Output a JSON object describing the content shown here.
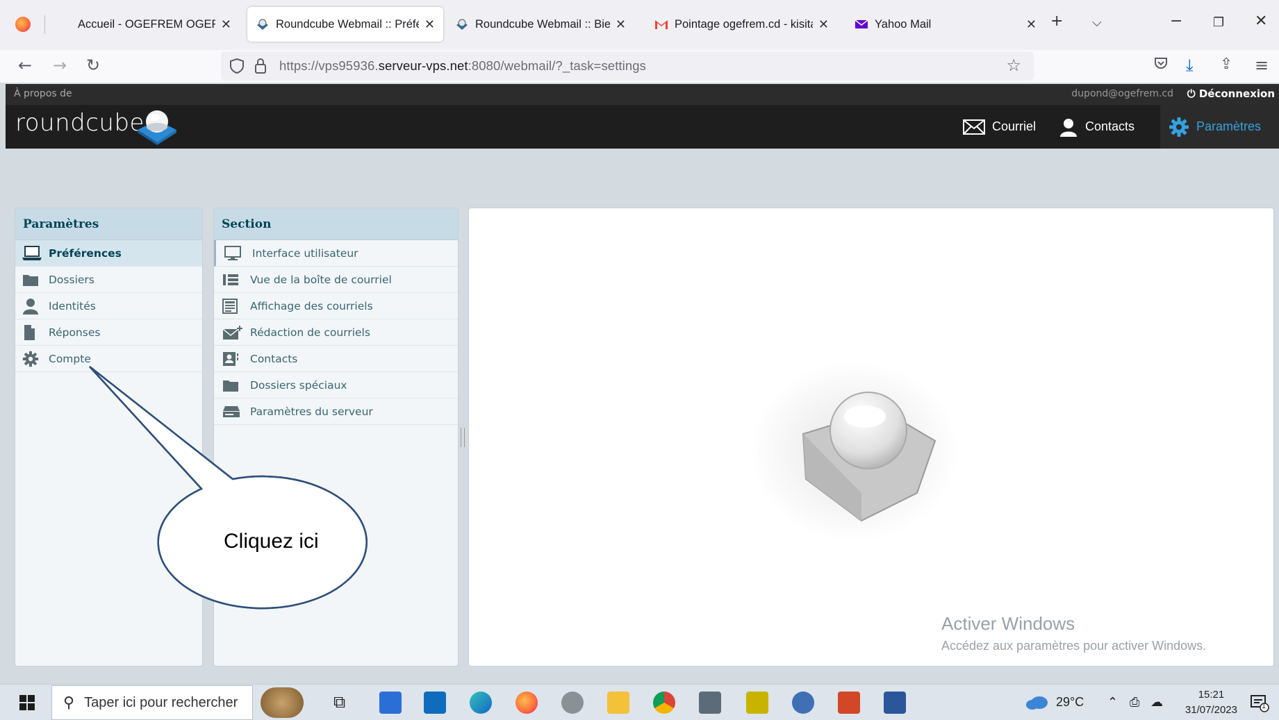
{
  "browser": {
    "tabs": [
      {
        "title": "Accueil - OGEFREM OGEFREM",
        "active": false,
        "icon": "firefox-icon"
      },
      {
        "title": "Roundcube Webmail :: Préférences",
        "active": true,
        "icon": "roundcube-icon"
      },
      {
        "title": "Roundcube Webmail :: Bienvenue",
        "active": false,
        "icon": "roundcube-icon"
      },
      {
        "title": "Pointage ogefrem.cd - kisitab",
        "active": false,
        "icon": "gmail-icon"
      },
      {
        "title": "Yahoo Mail",
        "active": false,
        "icon": "yahoo-mail-icon"
      }
    ],
    "url_prefix": "https://vps95936.",
    "url_domain": "serveur-vps.net",
    "url_suffix": ":8080/webmail/?_task=settings"
  },
  "roundcube": {
    "about": "À propos de",
    "user_email": "dupond@ogefrem.cd",
    "logout": "Déconnexion",
    "logo": "roundcube",
    "nav": {
      "mail": "Courriel",
      "contacts": "Contacts",
      "settings": "Paramètres"
    },
    "settings_panel": {
      "title": "Paramètres",
      "items": [
        {
          "label": "Préférences",
          "selected": true,
          "icon": "laptop-icon"
        },
        {
          "label": "Dossiers",
          "selected": false,
          "icon": "folder-icon"
        },
        {
          "label": "Identités",
          "selected": false,
          "icon": "user-icon"
        },
        {
          "label": "Réponses",
          "selected": false,
          "icon": "document-icon"
        },
        {
          "label": "Compte",
          "selected": false,
          "icon": "gear-icon"
        }
      ]
    },
    "section_panel": {
      "title": "Section",
      "items": [
        {
          "label": "Interface utilisateur",
          "icon": "monitor-icon"
        },
        {
          "label": "Vue de la boîte de courriel",
          "icon": "list-view-icon"
        },
        {
          "label": "Affichage des courriels",
          "icon": "message-display-icon"
        },
        {
          "label": "Rédaction de courriels",
          "icon": "compose-icon"
        },
        {
          "label": "Contacts",
          "icon": "contact-card-icon"
        },
        {
          "label": "Dossiers spéciaux",
          "icon": "folder-icon"
        },
        {
          "label": "Paramètres du serveur",
          "icon": "server-icon"
        }
      ]
    }
  },
  "callout": {
    "text": "Cliquez ici"
  },
  "windows_activation": {
    "title": "Activer Windows",
    "subtitle": "Accédez aux paramètres pour activer Windows."
  },
  "taskbar": {
    "search_placeholder": "Taper ici pour rechercher",
    "weather": "29°C",
    "time": "15:21",
    "date": "31/07/2023",
    "notification_count": "1"
  },
  "colors": {
    "accent": "#36a1e0",
    "header_bg": "#1e1e1e",
    "panel_head_bg": "#c7dbe6",
    "selected_row_bg": "#d5e5ee"
  }
}
